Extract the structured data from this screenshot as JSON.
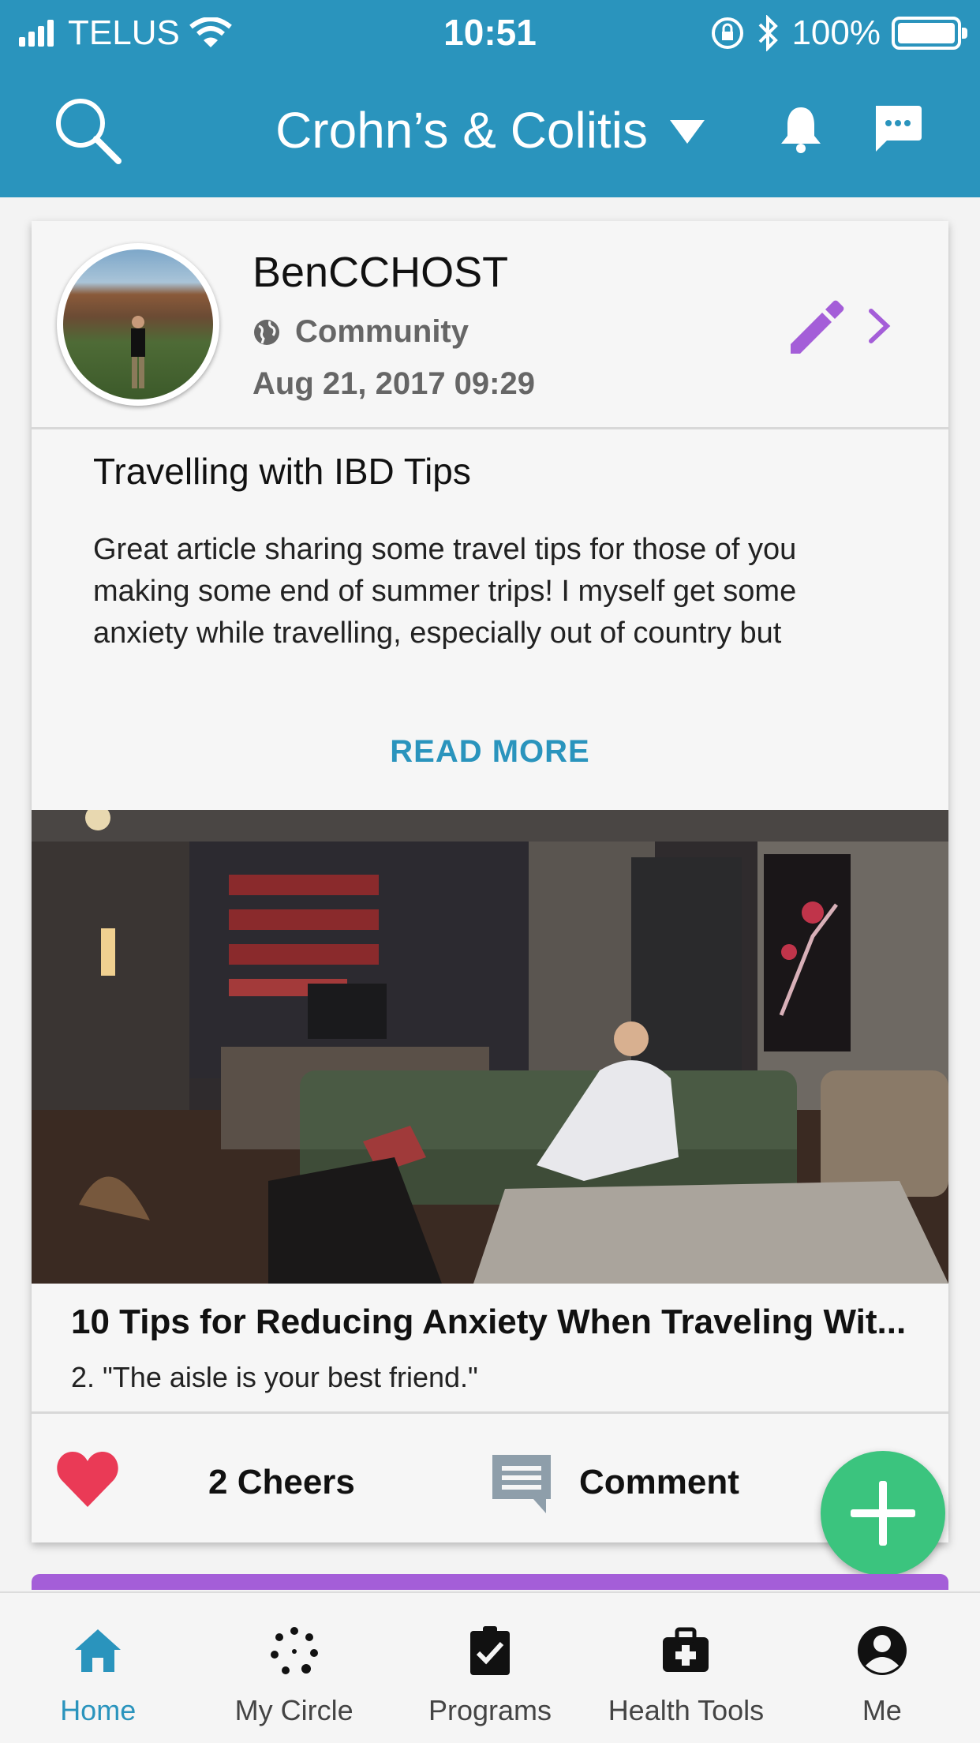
{
  "status_bar": {
    "carrier": "TELUS",
    "time": "10:51",
    "battery": "100%"
  },
  "header": {
    "title": "Crohn’s & Colitis",
    "icons": [
      "search-icon",
      "dropdown-caret-icon",
      "bell-icon",
      "chat-icon"
    ]
  },
  "post": {
    "author_name": "BenCCHOST",
    "visibility": "Community",
    "date": "Aug 21, 2017 09:29",
    "title": "Travelling with IBD Tips",
    "body": "Great article sharing some travel tips for those of you making some end of summer trips! I myself get some anxiety while travelling, especially out of country but",
    "read_more": "READ MORE",
    "link_title": "10 Tips for Reducing Anxiety When Traveling Wit...",
    "link_description": "2. \"The aisle is your best friend.\"",
    "cheers": "2 Cheers",
    "comment": "Comment"
  },
  "bottom_nav": {
    "items": [
      {
        "label": "Home",
        "icon": "home-icon",
        "active": true
      },
      {
        "label": "My Circle",
        "icon": "circle-dots-icon",
        "active": false
      },
      {
        "label": "Programs",
        "icon": "clipboard-check-icon",
        "active": false
      },
      {
        "label": "Health Tools",
        "icon": "medical-kit-icon",
        "active": false
      },
      {
        "label": "Me",
        "icon": "account-icon",
        "active": false
      }
    ]
  },
  "colors": {
    "header": "#2a94bd",
    "accent_purple": "#a45ed8",
    "fab_green": "#3bc47e",
    "heart_red": "#ea3a56"
  }
}
